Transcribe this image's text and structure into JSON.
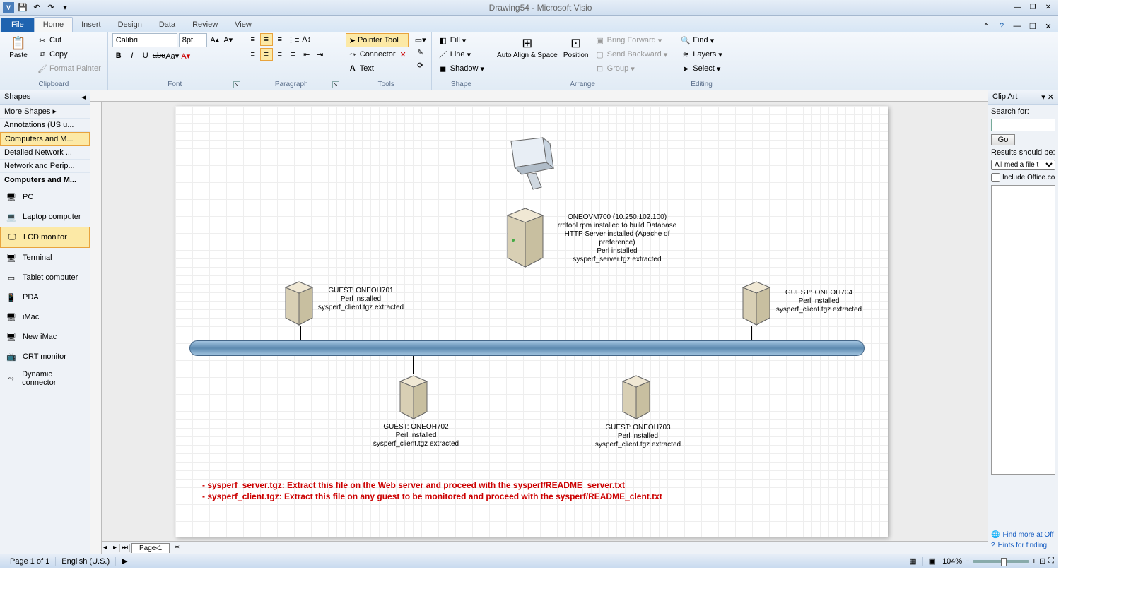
{
  "app": {
    "title": "Drawing54 - Microsoft Visio"
  },
  "qat": {
    "save": "💾",
    "undo": "↶",
    "redo": "↷"
  },
  "tabs": {
    "file": "File",
    "home": "Home",
    "insert": "Insert",
    "design": "Design",
    "data": "Data",
    "review": "Review",
    "view": "View"
  },
  "ribbon": {
    "clipboard": {
      "paste": "Paste",
      "cut": "Cut",
      "copy": "Copy",
      "format_painter": "Format Painter",
      "label": "Clipboard"
    },
    "font": {
      "name": "Calibri",
      "size": "8pt.",
      "label": "Font"
    },
    "paragraph": {
      "label": "Paragraph"
    },
    "tools": {
      "pointer": "Pointer Tool",
      "connector": "Connector",
      "text": "Text",
      "label": "Tools"
    },
    "shape": {
      "fill": "Fill",
      "line": "Line",
      "shadow": "Shadow",
      "label": "Shape"
    },
    "arrange": {
      "autoalign": "Auto Align & Space",
      "position": "Position",
      "bring_forward": "Bring Forward",
      "send_backward": "Send Backward",
      "group": "Group",
      "label": "Arrange"
    },
    "editing": {
      "find": "Find",
      "layers": "Layers",
      "select": "Select",
      "label": "Editing"
    }
  },
  "shapes_panel": {
    "header": "Shapes",
    "more": "More Shapes",
    "stencils": [
      "Annotations (US u...",
      "Computers and M...",
      "Detailed Network ...",
      "Network and Perip..."
    ],
    "active_stencil": "Computers and M...",
    "items": [
      {
        "name": "PC"
      },
      {
        "name": "Laptop computer"
      },
      {
        "name": "LCD monitor"
      },
      {
        "name": "Terminal"
      },
      {
        "name": "Tablet computer"
      },
      {
        "name": "PDA"
      },
      {
        "name": "iMac"
      },
      {
        "name": "New iMac"
      },
      {
        "name": "CRT monitor"
      },
      {
        "name": "Dynamic connector"
      }
    ]
  },
  "diagram": {
    "vm700": {
      "line1": "ONEOVM700 (10.250.102.100)",
      "line2": "rrdtool rpm installed to build Database",
      "line3": "HTTP Server installed (Apache of preference)",
      "line4": "Perl installed",
      "line5": "sysperf_server.tgz extracted"
    },
    "h701": {
      "line1": "GUEST: ONEOH701",
      "line2": "Perl installed",
      "line3": "sysperf_client.tgz extracted"
    },
    "h702": {
      "line1": "GUEST: ONEOH702",
      "line2": "Perl Installed",
      "line3": "sysperf_client.tgz extracted"
    },
    "h703": {
      "line1": "GUEST: ONEOH703",
      "line2": "Perl installed",
      "line3": "sysperf_client.tgz extracted"
    },
    "h704": {
      "line1": "GUEST:: ONEOH704",
      "line2": "Perl Installed",
      "line3": "sysperf_client.tgz extracted"
    },
    "note1": "- sysperf_server.tgz: Extract this file on the Web server and proceed with the sysperf/README_server.txt",
    "note2": "- sysperf_client.tgz: Extract this file on any guest to be monitored and proceed with the   sysperf/README_clent.txt"
  },
  "clipart": {
    "title": "Clip Art",
    "search_for": "Search for:",
    "go": "Go",
    "results_label": "Results should be:",
    "results_value": "All media file t",
    "include_office": "Include Office.co",
    "find_more": "Find more at Off",
    "hints": "Hints for finding"
  },
  "sheet": {
    "tab1": "Page-1"
  },
  "status": {
    "page": "Page 1 of 1",
    "lang": "English (U.S.)",
    "zoom": "104%"
  }
}
